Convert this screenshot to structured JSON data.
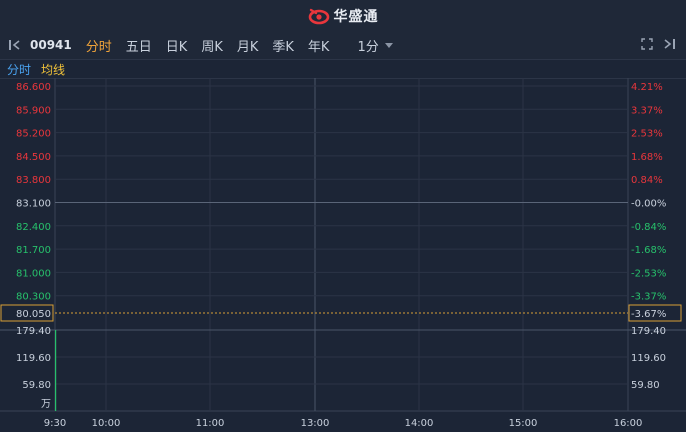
{
  "app": {
    "name": "华盛通"
  },
  "toolbar": {
    "stock_code": "00941",
    "tabs": [
      {
        "label": "分时",
        "active": true
      },
      {
        "label": "五日",
        "active": false
      },
      {
        "label": "日K",
        "active": false
      },
      {
        "label": "周K",
        "active": false
      },
      {
        "label": "月K",
        "active": false
      },
      {
        "label": "季K",
        "active": false
      },
      {
        "label": "年K",
        "active": false
      }
    ],
    "interval": "1分"
  },
  "legend": {
    "price": "分时",
    "average": "均线"
  },
  "chart_data": {
    "type": "line",
    "price_axis": {
      "min": 80.3,
      "max": 86.6,
      "ticks": [
        "86.600",
        "85.900",
        "85.200",
        "84.500",
        "83.800",
        "83.100",
        "82.400",
        "81.700",
        "81.000",
        "80.300"
      ],
      "pct_ticks": [
        "4.21%",
        "3.37%",
        "2.53%",
        "1.68%",
        "0.84%",
        "-0.00%",
        "-0.84%",
        "-1.68%",
        "-2.53%",
        "-3.37%"
      ],
      "reference": 83.1
    },
    "current": {
      "price": "80.050",
      "pct": "-3.67%"
    },
    "volume_axis": {
      "ticks": [
        "179.40",
        "119.60",
        "59.80"
      ],
      "unit": "万",
      "max": 179.4
    },
    "time_axis": [
      "9:30",
      "10:00",
      "11:00",
      "13:00",
      "14:00",
      "15:00",
      "16:00"
    ],
    "volume_bars": [
      {
        "time": "9:30",
        "value": 179.4
      }
    ],
    "colors": {
      "up": "#e8363c",
      "down": "#27c06b",
      "neutral": "#c8d0dc",
      "current_line": "#d9a035"
    }
  }
}
